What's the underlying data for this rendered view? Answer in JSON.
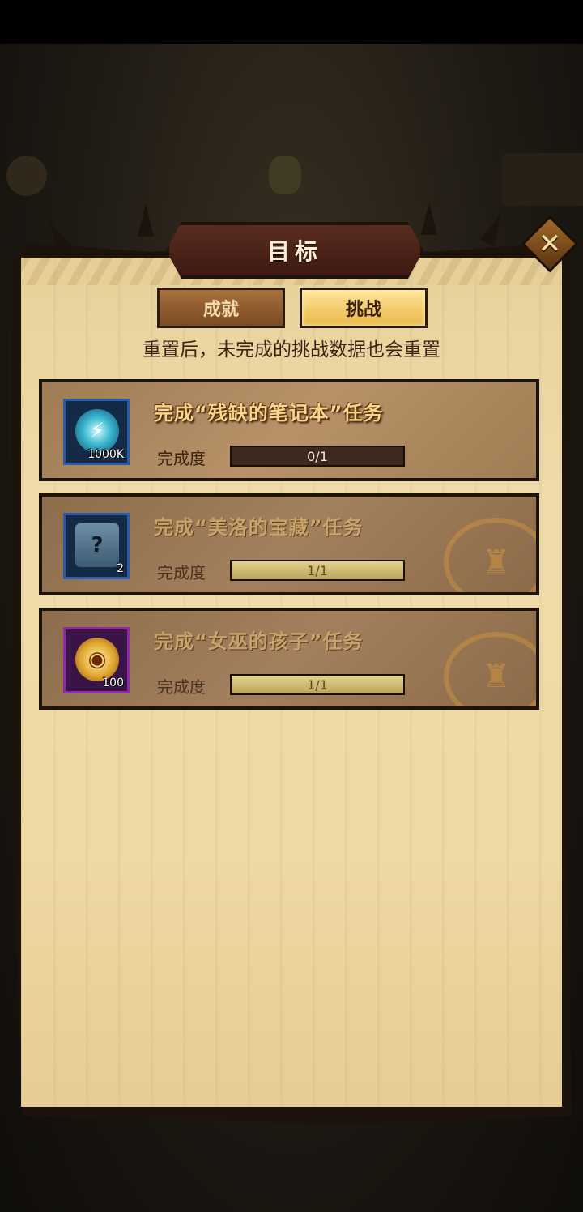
{
  "dialog": {
    "title": "目标",
    "close_label": "✕"
  },
  "tabs": [
    {
      "label": "成就",
      "active": false
    },
    {
      "label": "挑战",
      "active": true
    }
  ],
  "notice": "重置后，未完成的挑战数据也会重置",
  "quests": [
    {
      "title": "完成“残缺的笔记本”任务",
      "progress_label": "完成度",
      "progress_text": "0/1",
      "progress": 0,
      "reward_icon": "energy-orb-icon",
      "reward_count": "1000K",
      "completed": false
    },
    {
      "title": "完成“美洛的宝藏”任务",
      "progress_label": "完成度",
      "progress_text": "1/1",
      "progress": 1,
      "reward_icon": "mystery-chest-icon",
      "reward_count": "2",
      "completed": true
    },
    {
      "title": "完成“女巫的孩子”任务",
      "progress_label": "完成度",
      "progress_text": "1/1",
      "progress": 1,
      "reward_icon": "gold-coin-icon",
      "reward_count": "100",
      "completed": true
    }
  ],
  "colors": {
    "panel": "#eed8a4",
    "header": "#4a2218",
    "active_tab": "#f2c85e",
    "progress_fill": "#d6c47a"
  }
}
